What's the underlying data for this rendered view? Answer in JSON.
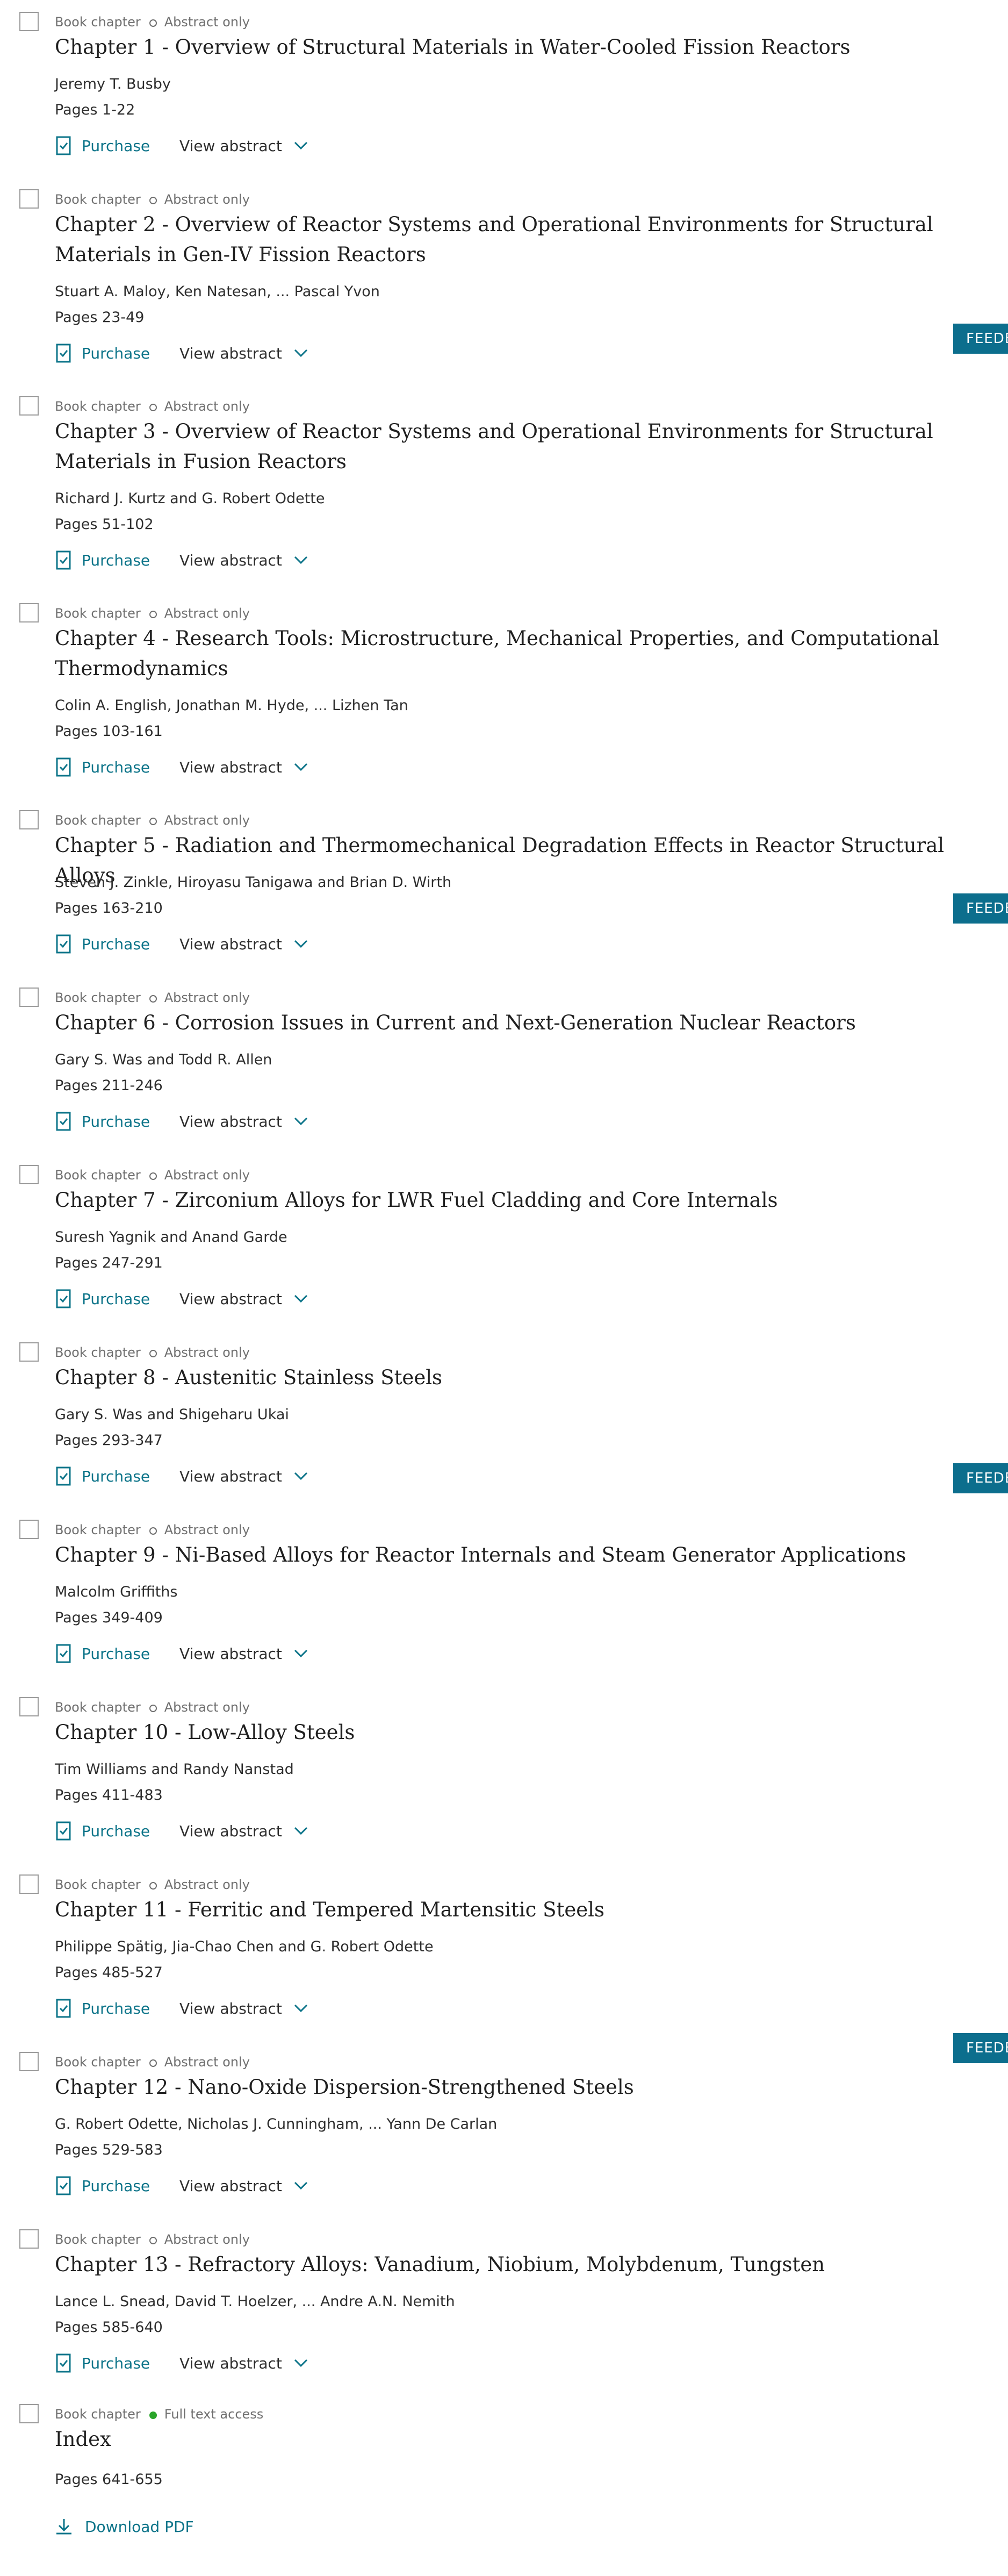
{
  "labels": {
    "type": "Book chapter",
    "access_abstract": "Abstract only",
    "access_full": "Full text access",
    "purchase": "Purchase",
    "view_abstract": "View abstract",
    "download_pdf": "Download PDF",
    "feedback": "FEEDBACK"
  },
  "colors": {
    "link": "#0c7489",
    "feedback_bg": "#0c6e8d",
    "full_access_dot": "#2aa52a"
  },
  "chapters": [
    {
      "title": "Chapter 1 - Overview of Structural Materials in Water-Cooled Fission Reactors",
      "authors": "Jeremy T. Busby",
      "pages": "Pages 1-22"
    },
    {
      "title": "Chapter 2 - Overview of Reactor Systems and Operational Environments for Structural Materials in Gen-IV Fission Reactors",
      "authors": "Stuart A. Maloy, Ken Natesan, ... Pascal Yvon",
      "pages": "Pages 23-49"
    },
    {
      "title": "Chapter 3 - Overview of Reactor Systems and Operational Environments for Structural Materials in Fusion Reactors",
      "authors": "Richard J. Kurtz and G. Robert Odette",
      "pages": "Pages 51-102"
    },
    {
      "title": "Chapter 4 - Research Tools: Microstructure, Mechanical Properties, and Computational Thermodynamics",
      "authors": "Colin A. English, Jonathan M. Hyde, ... Lizhen Tan",
      "pages": "Pages 103-161"
    },
    {
      "title": "Chapter 5 - Radiation and Thermomechanical Degradation Effects in Reactor Structural Alloys",
      "authors": "Steven J. Zinkle, Hiroyasu Tanigawa and Brian D. Wirth",
      "pages": "Pages 163-210"
    },
    {
      "title": "Chapter 6 - Corrosion Issues in Current and Next-Generation Nuclear Reactors",
      "authors": "Gary S. Was and Todd R. Allen",
      "pages": "Pages 211-246"
    },
    {
      "title": "Chapter 7 - Zirconium Alloys for LWR Fuel Cladding and Core Internals",
      "authors": "Suresh Yagnik and Anand Garde",
      "pages": "Pages 247-291"
    },
    {
      "title": "Chapter 8 - Austenitic Stainless Steels",
      "authors": "Gary S. Was and Shigeharu Ukai",
      "pages": "Pages 293-347"
    },
    {
      "title": "Chapter 9 - Ni-Based Alloys for Reactor Internals and Steam Generator Applications",
      "authors": "Malcolm Griffiths",
      "pages": "Pages 349-409"
    },
    {
      "title": "Chapter 10 - Low-Alloy Steels",
      "authors": "Tim Williams and Randy Nanstad",
      "pages": "Pages 411-483"
    },
    {
      "title": "Chapter 11 - Ferritic and Tempered Martensitic Steels",
      "authors": "Philippe Spätig, Jia-Chao Chen and G. Robert Odette",
      "pages": "Pages 485-527"
    },
    {
      "title": "Chapter 12 - Nano-Oxide Dispersion-Strengthened Steels",
      "authors": "G. Robert Odette, Nicholas J. Cunningham, ... Yann De Carlan",
      "pages": "Pages 529-583"
    },
    {
      "title": "Chapter 13 - Refractory Alloys: Vanadium, Niobium, Molybdenum, Tungsten",
      "authors": "Lance L. Snead, David T. Hoelzer, ... Andre A.N. Nemith",
      "pages": "Pages 585-640"
    }
  ],
  "index": {
    "title": "Index",
    "pages": "Pages 641-655"
  }
}
